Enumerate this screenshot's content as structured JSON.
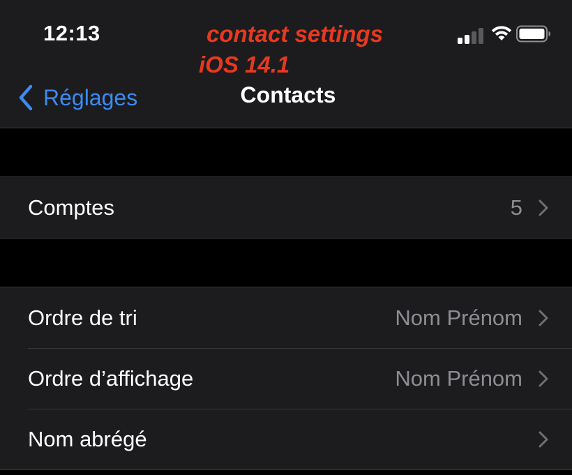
{
  "status_bar": {
    "time": "12:13",
    "signal_bars": 2,
    "wifi": true,
    "battery_level": 1.0
  },
  "annotation": {
    "line1": "contact settings",
    "line2": "iOS 14.1",
    "color": "#e8391f"
  },
  "nav": {
    "back_label": "Réglages",
    "title": "Contacts",
    "accent_color": "#3d8bf0"
  },
  "groups": [
    {
      "rows": [
        {
          "label": "Comptes",
          "value": "5"
        }
      ]
    },
    {
      "rows": [
        {
          "label": "Ordre de tri",
          "value": "Nom Prénom"
        },
        {
          "label": "Ordre d’affichage",
          "value": "Nom Prénom"
        },
        {
          "label": "Nom abrégé",
          "value": ""
        }
      ]
    }
  ],
  "icons": {
    "back": "chevron-left-icon",
    "disclosure": "chevron-right-icon",
    "signal": "cellular-signal-icon",
    "wifi": "wifi-icon",
    "battery": "battery-icon"
  }
}
